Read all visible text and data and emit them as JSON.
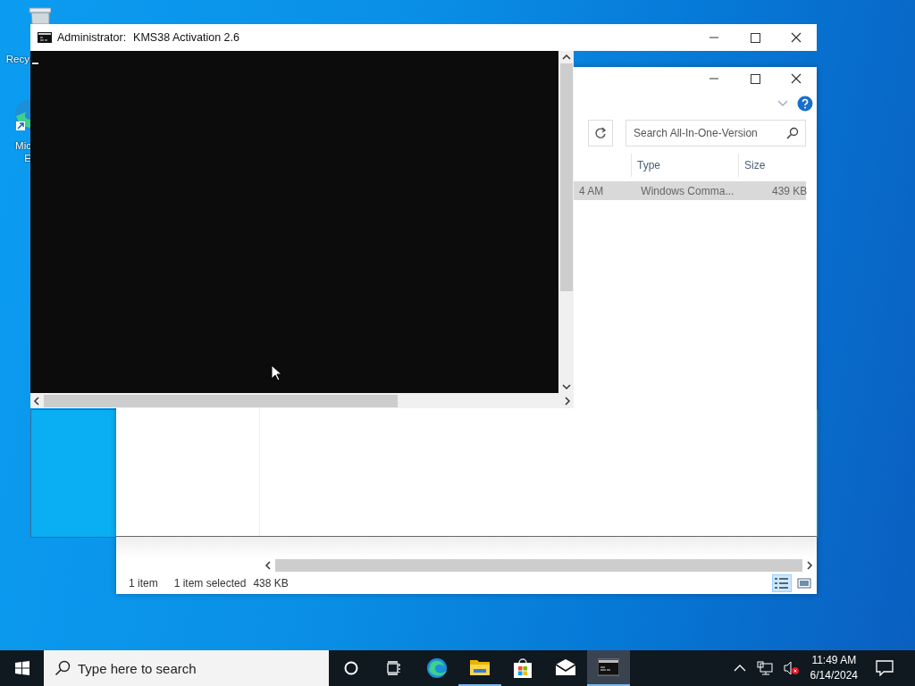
{
  "desktop_icons": [
    {
      "kind": "bin",
      "lines": [
        "Recy"
      ]
    },
    {
      "kind": "edge",
      "lines": [
        "Mic",
        "E"
      ]
    }
  ],
  "explorer_window": {
    "search": {
      "placeholder": "Search All-In-One-Version"
    },
    "columns": [
      "Type",
      "Size"
    ],
    "rows": [
      {
        "column_1": "4 AM",
        "type": "Windows Comma...",
        "size": "439 KB",
        "selected": true
      }
    ],
    "status": {
      "count": "1 item",
      "selection": "1 item selected",
      "size": "438 KB"
    },
    "views": [
      {
        "kind": "details",
        "selected": true
      },
      {
        "kind": "tiles",
        "selected": false
      }
    ]
  },
  "console_window": {
    "title_prefix": "Administrator:",
    "title": "KMS38 Activation 2.6"
  },
  "taskbar": {
    "search": {
      "placeholder": "Type here to search"
    },
    "apps": [
      {
        "kind": "edge",
        "running": false,
        "selected": false
      },
      {
        "kind": "folder",
        "running": true,
        "selected": false
      },
      {
        "kind": "store",
        "running": false,
        "selected": false
      },
      {
        "kind": "mail",
        "running": false,
        "selected": false
      },
      {
        "kind": "console",
        "running": true,
        "selected": true
      }
    ],
    "time": "11:49 AM",
    "date": "6/14/2024"
  }
}
